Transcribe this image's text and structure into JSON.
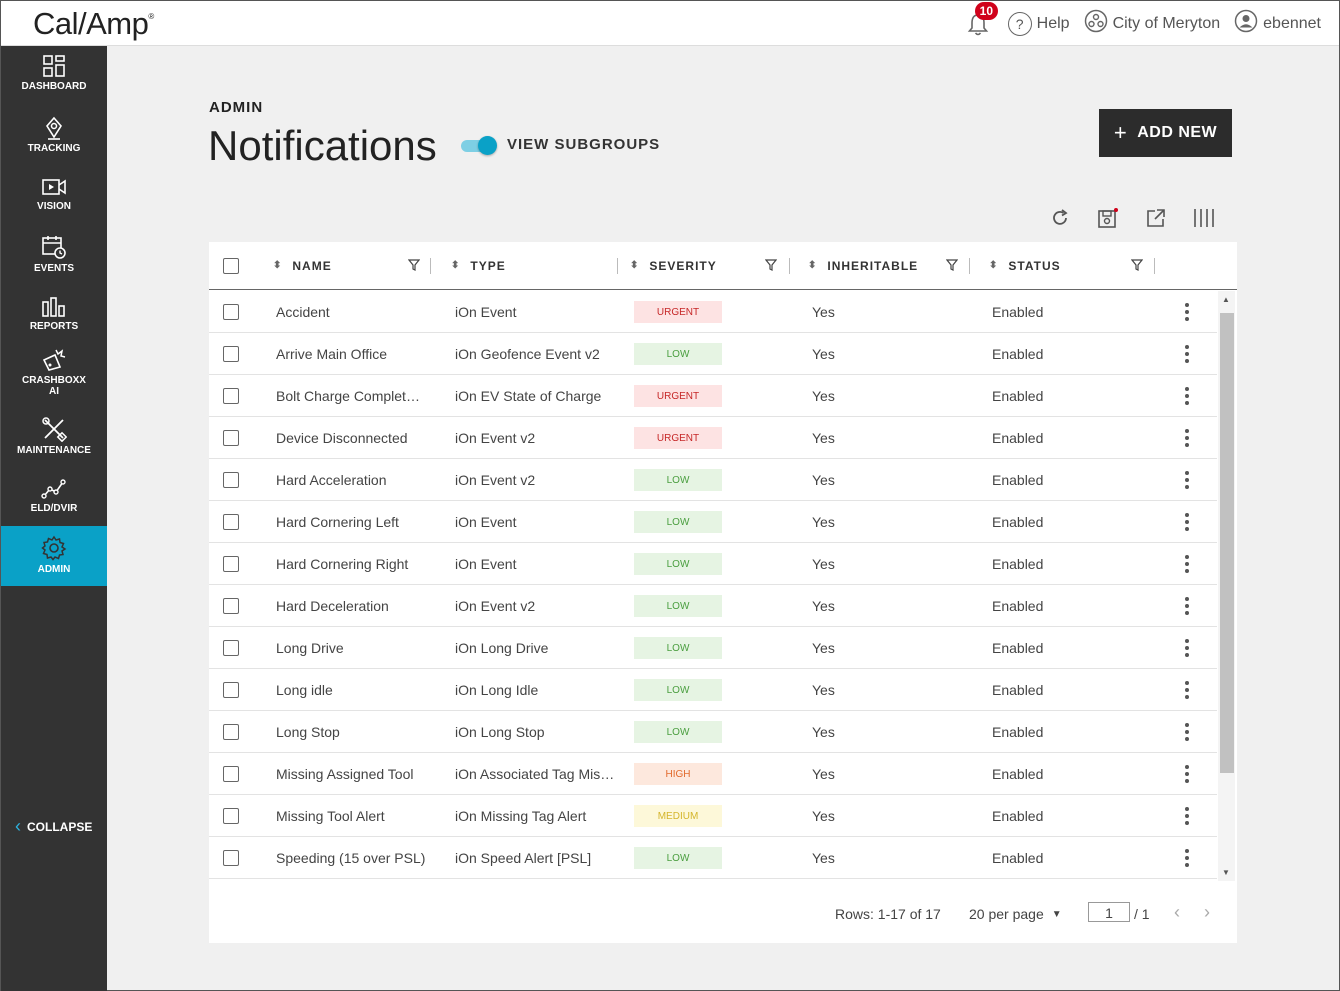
{
  "app": {
    "logo": "Cal/Amp",
    "logo_tm": "®",
    "notifications_count": "10",
    "help_label": "Help",
    "org_label": "City of Meryton",
    "user_label": "ebennet"
  },
  "sidebar": {
    "items": [
      {
        "label": "DASHBOARD",
        "icon": "dashboard-icon"
      },
      {
        "label": "TRACKING",
        "icon": "tracking-icon"
      },
      {
        "label": "VISION",
        "icon": "vision-icon"
      },
      {
        "label": "EVENTS",
        "icon": "events-icon"
      },
      {
        "label": "REPORTS",
        "icon": "reports-icon"
      },
      {
        "label": "CRASHBOXX",
        "label2": "AI",
        "icon": "crashboxx-icon"
      },
      {
        "label": "MAINTENANCE",
        "icon": "maintenance-icon"
      },
      {
        "label": "ELD/DVIR",
        "icon": "eld-icon"
      },
      {
        "label": "ADMIN",
        "icon": "gear-icon",
        "active": true
      }
    ],
    "collapse_label": "COLLAPSE"
  },
  "header": {
    "eyebrow": "ADMIN",
    "title": "Notifications",
    "toggle_label": "VIEW SUBGROUPS",
    "toggle_on": true,
    "add_button": "ADD NEW"
  },
  "table": {
    "columns": [
      "NAME",
      "TYPE",
      "SEVERITY",
      "INHERITABLE",
      "STATUS"
    ],
    "rows": [
      {
        "name": "Accident",
        "type": "iOn Event",
        "severity": "URGENT",
        "sev_class": "urgent",
        "inheritable": "Yes",
        "status": "Enabled"
      },
      {
        "name": "Arrive Main Office",
        "type": "iOn Geofence Event v2",
        "severity": "LOW",
        "sev_class": "low",
        "inheritable": "Yes",
        "status": "Enabled"
      },
      {
        "name": "Bolt Charge Complet…",
        "type": "iOn EV State of Charge",
        "severity": "URGENT",
        "sev_class": "urgent",
        "inheritable": "Yes",
        "status": "Enabled"
      },
      {
        "name": "Device Disconnected",
        "type": "iOn Event v2",
        "severity": "URGENT",
        "sev_class": "urgent",
        "inheritable": "Yes",
        "status": "Enabled"
      },
      {
        "name": "Hard Acceleration",
        "type": "iOn Event v2",
        "severity": "LOW",
        "sev_class": "low",
        "inheritable": "Yes",
        "status": "Enabled"
      },
      {
        "name": "Hard Cornering Left",
        "type": "iOn Event",
        "severity": "LOW",
        "sev_class": "low",
        "inheritable": "Yes",
        "status": "Enabled"
      },
      {
        "name": "Hard Cornering Right",
        "type": "iOn Event",
        "severity": "LOW",
        "sev_class": "low",
        "inheritable": "Yes",
        "status": "Enabled"
      },
      {
        "name": "Hard Deceleration",
        "type": "iOn Event v2",
        "severity": "LOW",
        "sev_class": "low",
        "inheritable": "Yes",
        "status": "Enabled"
      },
      {
        "name": "Long Drive",
        "type": "iOn Long Drive",
        "severity": "LOW",
        "sev_class": "low",
        "inheritable": "Yes",
        "status": "Enabled"
      },
      {
        "name": "Long idle",
        "type": "iOn Long Idle",
        "severity": "LOW",
        "sev_class": "low",
        "inheritable": "Yes",
        "status": "Enabled"
      },
      {
        "name": "Long Stop",
        "type": "iOn Long Stop",
        "severity": "LOW",
        "sev_class": "low",
        "inheritable": "Yes",
        "status": "Enabled"
      },
      {
        "name": "Missing Assigned Tool",
        "type": "iOn Associated Tag Mis…",
        "severity": "HIGH",
        "sev_class": "high",
        "inheritable": "Yes",
        "status": "Enabled"
      },
      {
        "name": "Missing Tool Alert",
        "type": "iOn Missing Tag Alert",
        "severity": "MEDIUM",
        "sev_class": "medium",
        "inheritable": "Yes",
        "status": "Enabled"
      },
      {
        "name": "Speeding (15 over PSL)",
        "type": "iOn Speed Alert [PSL]",
        "severity": "LOW",
        "sev_class": "low",
        "inheritable": "Yes",
        "status": "Enabled"
      }
    ]
  },
  "footer": {
    "rows_info": "Rows: 1-17 of 17",
    "per_page": "20 per page",
    "page_value": "1",
    "page_total": "/ 1"
  },
  "colors": {
    "accent": "#0aa1c7",
    "sidebar_bg": "#333333",
    "badge": "#d0021b"
  }
}
